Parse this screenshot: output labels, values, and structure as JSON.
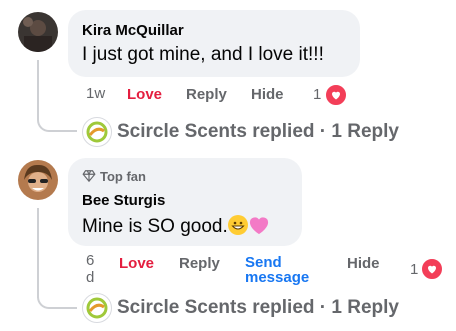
{
  "comments": [
    {
      "author": "Kira McQuillar",
      "text": "I just got mine, and I love it!!!",
      "time": "1w",
      "love_label": "Love",
      "reply_label": "Reply",
      "hide_label": "Hide",
      "reaction_count": "1",
      "replies_summary": {
        "page": "Scircle Scents replied",
        "separator": "·",
        "count": "1 Reply"
      }
    },
    {
      "badge": "Top fan",
      "author": "Bee Sturgis",
      "text": "Mine is SO good.",
      "time_line1": "6",
      "time_line2": "d",
      "love_label": "Love",
      "reply_label": "Reply",
      "send_line1": "Send",
      "send_line2": "message",
      "hide_label": "Hide",
      "reaction_count": "1",
      "replies_summary": {
        "page": "Scircle Scents replied",
        "separator": "·",
        "count": "1 Reply"
      }
    }
  ],
  "icons": {
    "reaction": "heart-icon",
    "badge": "diamond-icon",
    "emoji1": "grinning-face-icon",
    "emoji2": "pink-heart-icon"
  },
  "colors": {
    "love": "#e41e3f",
    "link": "#1877f2",
    "bubble": "#f0f2f5",
    "secondary": "#65676b"
  }
}
